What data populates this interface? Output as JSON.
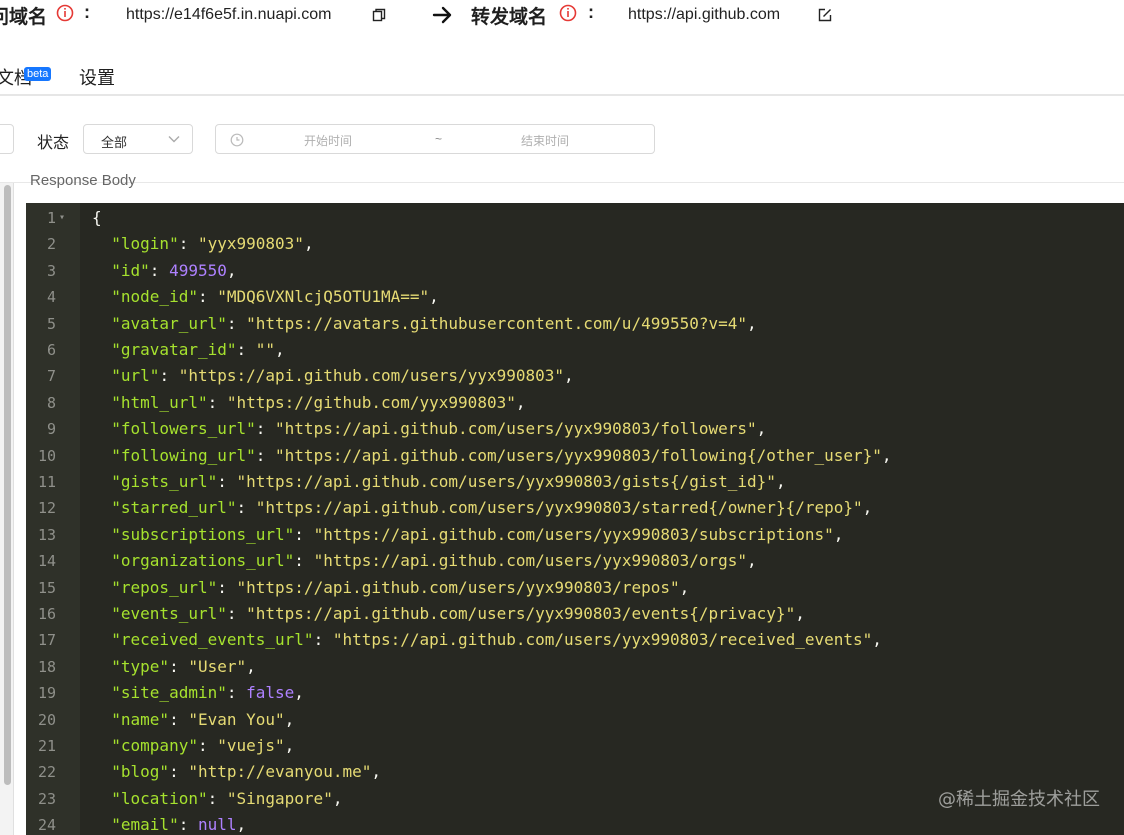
{
  "domain_bar": {
    "source_label": "问域名",
    "source_url": "https://e14f6e5f.in.nuapi.com",
    "target_label": "转发域名",
    "target_url": "https://api.github.com",
    "colon": ":"
  },
  "tabs": [
    {
      "label": "文档",
      "badge": "beta"
    },
    {
      "label": "设置"
    }
  ],
  "filters": {
    "status_label": "状态",
    "status_value": "全部",
    "start_placeholder": "开始时间",
    "range_separator": "~",
    "end_placeholder": "结束时间"
  },
  "response_body_label": "Response Body",
  "code_lines": [
    {
      "no": "1",
      "fold": true,
      "parts": [
        [
          "p",
          "{"
        ]
      ]
    },
    {
      "no": "2",
      "parts": [
        [
          "p",
          "  "
        ],
        [
          "k",
          "\"login\""
        ],
        [
          "p",
          ": "
        ],
        [
          "s",
          "\"yyx990803\""
        ],
        [
          "p",
          ","
        ]
      ]
    },
    {
      "no": "3",
      "parts": [
        [
          "p",
          "  "
        ],
        [
          "k",
          "\"id\""
        ],
        [
          "p",
          ": "
        ],
        [
          "n",
          "499550"
        ],
        [
          "p",
          ","
        ]
      ]
    },
    {
      "no": "4",
      "parts": [
        [
          "p",
          "  "
        ],
        [
          "k",
          "\"node_id\""
        ],
        [
          "p",
          ": "
        ],
        [
          "s",
          "\"MDQ6VXNlcjQ5OTU1MA==\""
        ],
        [
          "p",
          ","
        ]
      ]
    },
    {
      "no": "5",
      "parts": [
        [
          "p",
          "  "
        ],
        [
          "k",
          "\"avatar_url\""
        ],
        [
          "p",
          ": "
        ],
        [
          "s",
          "\"https://avatars.githubusercontent.com/u/499550?v=4\""
        ],
        [
          "p",
          ","
        ]
      ]
    },
    {
      "no": "6",
      "parts": [
        [
          "p",
          "  "
        ],
        [
          "k",
          "\"gravatar_id\""
        ],
        [
          "p",
          ": "
        ],
        [
          "s",
          "\"\""
        ],
        [
          "p",
          ","
        ]
      ]
    },
    {
      "no": "7",
      "parts": [
        [
          "p",
          "  "
        ],
        [
          "k",
          "\"url\""
        ],
        [
          "p",
          ": "
        ],
        [
          "s",
          "\"https://api.github.com/users/yyx990803\""
        ],
        [
          "p",
          ","
        ]
      ]
    },
    {
      "no": "8",
      "parts": [
        [
          "p",
          "  "
        ],
        [
          "k",
          "\"html_url\""
        ],
        [
          "p",
          ": "
        ],
        [
          "s",
          "\"https://github.com/yyx990803\""
        ],
        [
          "p",
          ","
        ]
      ]
    },
    {
      "no": "9",
      "parts": [
        [
          "p",
          "  "
        ],
        [
          "k",
          "\"followers_url\""
        ],
        [
          "p",
          ": "
        ],
        [
          "s",
          "\"https://api.github.com/users/yyx990803/followers\""
        ],
        [
          "p",
          ","
        ]
      ]
    },
    {
      "no": "10",
      "parts": [
        [
          "p",
          "  "
        ],
        [
          "k",
          "\"following_url\""
        ],
        [
          "p",
          ": "
        ],
        [
          "s",
          "\"https://api.github.com/users/yyx990803/following{/other_user}\""
        ],
        [
          "p",
          ","
        ]
      ]
    },
    {
      "no": "11",
      "parts": [
        [
          "p",
          "  "
        ],
        [
          "k",
          "\"gists_url\""
        ],
        [
          "p",
          ": "
        ],
        [
          "s",
          "\"https://api.github.com/users/yyx990803/gists{/gist_id}\""
        ],
        [
          "p",
          ","
        ]
      ]
    },
    {
      "no": "12",
      "parts": [
        [
          "p",
          "  "
        ],
        [
          "k",
          "\"starred_url\""
        ],
        [
          "p",
          ": "
        ],
        [
          "s",
          "\"https://api.github.com/users/yyx990803/starred{/owner}{/repo}\""
        ],
        [
          "p",
          ","
        ]
      ]
    },
    {
      "no": "13",
      "parts": [
        [
          "p",
          "  "
        ],
        [
          "k",
          "\"subscriptions_url\""
        ],
        [
          "p",
          ": "
        ],
        [
          "s",
          "\"https://api.github.com/users/yyx990803/subscriptions\""
        ],
        [
          "p",
          ","
        ]
      ]
    },
    {
      "no": "14",
      "parts": [
        [
          "p",
          "  "
        ],
        [
          "k",
          "\"organizations_url\""
        ],
        [
          "p",
          ": "
        ],
        [
          "s",
          "\"https://api.github.com/users/yyx990803/orgs\""
        ],
        [
          "p",
          ","
        ]
      ]
    },
    {
      "no": "15",
      "parts": [
        [
          "p",
          "  "
        ],
        [
          "k",
          "\"repos_url\""
        ],
        [
          "p",
          ": "
        ],
        [
          "s",
          "\"https://api.github.com/users/yyx990803/repos\""
        ],
        [
          "p",
          ","
        ]
      ]
    },
    {
      "no": "16",
      "parts": [
        [
          "p",
          "  "
        ],
        [
          "k",
          "\"events_url\""
        ],
        [
          "p",
          ": "
        ],
        [
          "s",
          "\"https://api.github.com/users/yyx990803/events{/privacy}\""
        ],
        [
          "p",
          ","
        ]
      ]
    },
    {
      "no": "17",
      "parts": [
        [
          "p",
          "  "
        ],
        [
          "k",
          "\"received_events_url\""
        ],
        [
          "p",
          ": "
        ],
        [
          "s",
          "\"https://api.github.com/users/yyx990803/received_events\""
        ],
        [
          "p",
          ","
        ]
      ]
    },
    {
      "no": "18",
      "parts": [
        [
          "p",
          "  "
        ],
        [
          "k",
          "\"type\""
        ],
        [
          "p",
          ": "
        ],
        [
          "s",
          "\"User\""
        ],
        [
          "p",
          ","
        ]
      ]
    },
    {
      "no": "19",
      "parts": [
        [
          "p",
          "  "
        ],
        [
          "k",
          "\"site_admin\""
        ],
        [
          "p",
          ": "
        ],
        [
          "n",
          "false"
        ],
        [
          "p",
          ","
        ]
      ]
    },
    {
      "no": "20",
      "parts": [
        [
          "p",
          "  "
        ],
        [
          "k",
          "\"name\""
        ],
        [
          "p",
          ": "
        ],
        [
          "s",
          "\"Evan You\""
        ],
        [
          "p",
          ","
        ]
      ]
    },
    {
      "no": "21",
      "parts": [
        [
          "p",
          "  "
        ],
        [
          "k",
          "\"company\""
        ],
        [
          "p",
          ": "
        ],
        [
          "s",
          "\"vuejs\""
        ],
        [
          "p",
          ","
        ]
      ]
    },
    {
      "no": "22",
      "parts": [
        [
          "p",
          "  "
        ],
        [
          "k",
          "\"blog\""
        ],
        [
          "p",
          ": "
        ],
        [
          "s",
          "\"http://evanyou.me\""
        ],
        [
          "p",
          ","
        ]
      ]
    },
    {
      "no": "23",
      "parts": [
        [
          "p",
          "  "
        ],
        [
          "k",
          "\"location\""
        ],
        [
          "p",
          ": "
        ],
        [
          "s",
          "\"Singapore\""
        ],
        [
          "p",
          ","
        ]
      ]
    },
    {
      "no": "24",
      "parts": [
        [
          "p",
          "  "
        ],
        [
          "k",
          "\"email\""
        ],
        [
          "p",
          ": "
        ],
        [
          "n",
          "null"
        ],
        [
          "p",
          ","
        ]
      ]
    }
  ],
  "watermark": "@稀土掘金技术社区",
  "colors": {
    "editor_bg": "#272822",
    "key": "#a6e22e",
    "string": "#e6db74",
    "number": "#ae81ff",
    "info_red": "#e53935",
    "beta_blue": "#1677ff"
  },
  "icons": [
    "info-icon",
    "copy-icon",
    "arrow-right-icon",
    "edit-icon",
    "chevron-down-icon",
    "clock-icon",
    "fold-arrow-icon"
  ]
}
